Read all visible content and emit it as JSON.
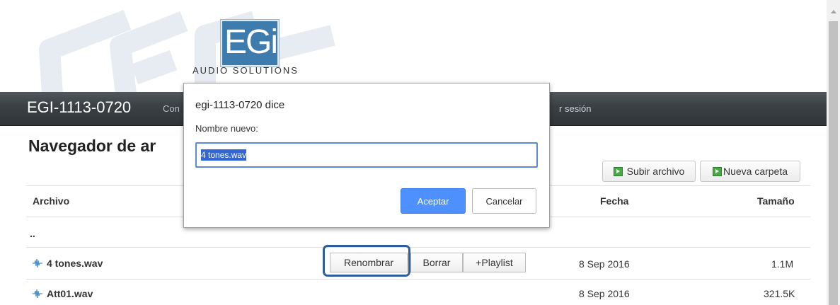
{
  "brand": {
    "logo_text": "EGi",
    "tagline": "AUDIO SOLUTIONS",
    "logo_color": "#3f7cae"
  },
  "header": {
    "device_name": "EGI-1113-0720",
    "nav_partial": "Con",
    "nav_logout_partial": "r sesión"
  },
  "main": {
    "title": "Navegador de ar",
    "toolbar": {
      "upload_label": "Subir archivo",
      "new_folder_label": "Nueva carpeta"
    },
    "columns": {
      "file": "Archivo",
      "date": "Fecha",
      "size": "Tamaño"
    },
    "parent_dir": "..",
    "rows": [
      {
        "name": "4 tones.wav",
        "date": "8 Sep 2016",
        "size": "1.1M"
      },
      {
        "name": "Att01.wav",
        "date": "8 Sep 2016",
        "size": "321.5K"
      }
    ],
    "row_actions": {
      "rename": "Renombrar",
      "delete": "Borrar",
      "playlist": "+Playlist"
    }
  },
  "dialog": {
    "title": "egi-1113-0720 dice",
    "label": "Nombre nuevo:",
    "input_value": "4 tones.wav",
    "ok_label": "Aceptar",
    "cancel_label": "Cancelar",
    "ok_color": "#4d90fe"
  },
  "icons": {
    "play": "play-icon",
    "waveform": "waveform-icon"
  }
}
